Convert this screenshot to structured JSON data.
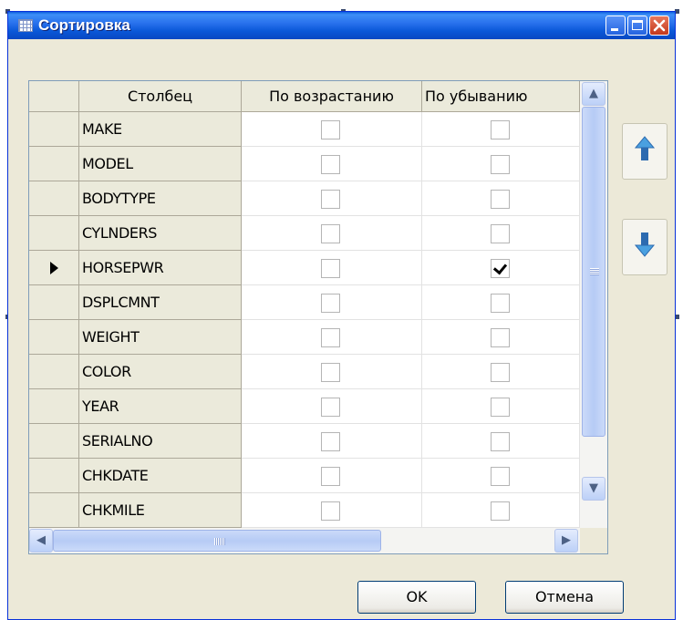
{
  "window": {
    "title": "Сортировка",
    "icon": "table-icon",
    "controls": [
      "minimize-icon",
      "maximize-icon",
      "close-icon"
    ]
  },
  "grid": {
    "columns": [
      "Столбец",
      "По возрастанию",
      "По убыванию"
    ],
    "rows": [
      {
        "name": "MAKE",
        "asc": false,
        "desc": false,
        "current": false
      },
      {
        "name": "MODEL",
        "asc": false,
        "desc": false,
        "current": false
      },
      {
        "name": "BODYTYPE",
        "asc": false,
        "desc": false,
        "current": false
      },
      {
        "name": "CYLNDERS",
        "asc": false,
        "desc": false,
        "current": false
      },
      {
        "name": "HORSEPWR",
        "asc": false,
        "desc": true,
        "current": true
      },
      {
        "name": "DSPLCMNT",
        "asc": false,
        "desc": false,
        "current": false
      },
      {
        "name": "WEIGHT",
        "asc": false,
        "desc": false,
        "current": false
      },
      {
        "name": "COLOR",
        "asc": false,
        "desc": false,
        "current": false
      },
      {
        "name": "YEAR",
        "asc": false,
        "desc": false,
        "current": false
      },
      {
        "name": "SERIALNO",
        "asc": false,
        "desc": false,
        "current": false
      },
      {
        "name": "CHKDATE",
        "asc": false,
        "desc": false,
        "current": false
      },
      {
        "name": "CHKMILE",
        "asc": false,
        "desc": false,
        "current": false
      }
    ]
  },
  "side_buttons": {
    "move_up_icon": "arrow-up-icon",
    "move_down_icon": "arrow-down-icon"
  },
  "buttons": {
    "ok": "OK",
    "cancel": "Отмена"
  },
  "colors": {
    "titlebar": "#0a58d8",
    "dialog_bg": "#ece9d8",
    "check": "#000000"
  }
}
